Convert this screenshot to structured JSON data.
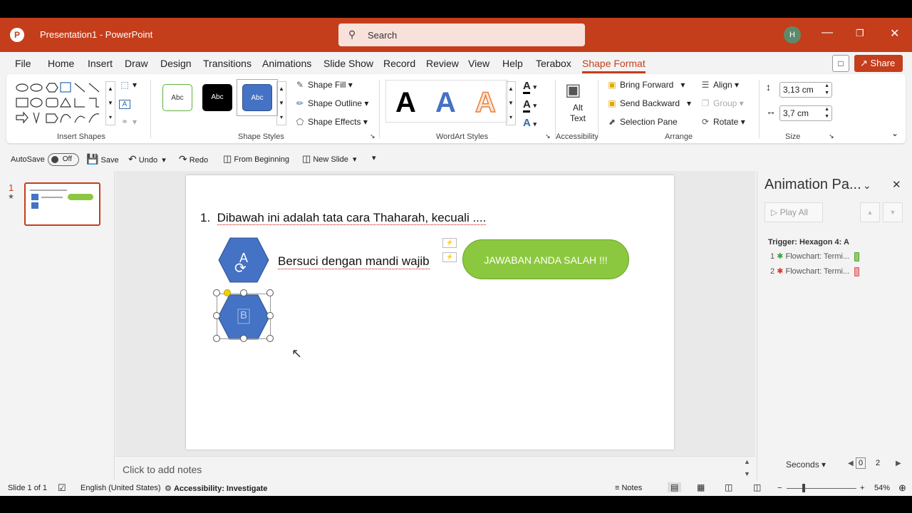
{
  "app": {
    "title": "Presentation1  -  PowerPoint",
    "logo": "P",
    "search_label": "Search",
    "avatar_initial": "H",
    "brand_color": "#c43e1c"
  },
  "menus": [
    "File",
    "Home",
    "Insert",
    "Draw",
    "Design",
    "Transitions",
    "Animations",
    "Slide Show",
    "Record",
    "Review",
    "View",
    "Help",
    "Terabox",
    "Shape Format"
  ],
  "active_menu": "Shape Format",
  "share_label": "Share",
  "ribbon": {
    "groups": {
      "insert_shapes": "Insert Shapes",
      "shape_styles": "Shape Styles",
      "wordart_styles": "WordArt Styles",
      "accessibility": "Accessibility",
      "arrange": "Arrange",
      "size": "Size"
    },
    "style_samples": [
      "Abc",
      "Abc",
      "Abc"
    ],
    "shape_fill": "Shape Fill",
    "shape_outline": "Shape Outline",
    "shape_effects": "Shape Effects",
    "wordart_letter": "A",
    "alt_text": "Alt Text",
    "bring_forward": "Bring Forward",
    "send_backward": "Send Backward",
    "selection_pane": "Selection Pane",
    "align": "Align",
    "group": "Group",
    "rotate": "Rotate",
    "height": "3,13 cm",
    "width": "3,7 cm"
  },
  "qat": {
    "autosave": "AutoSave",
    "autosave_state": "Off",
    "save": "Save",
    "undo": "Undo",
    "redo": "Redo",
    "from_beginning": "From Beginning",
    "new_slide": "New Slide"
  },
  "thumb_number": "1",
  "slide": {
    "question_number": "1.",
    "question": "Dibawah ini adalah tata cara Thaharah, kecuali ....",
    "hexagon_a_label": "A",
    "hexagon_b_label": "B",
    "option_a_text": "Bersuci dengan mandi wajib",
    "feedback": "JAWABAN ANDA SALAH !!!"
  },
  "notes_placeholder": "Click to add notes",
  "animation_pane": {
    "title": "Animation Pa...",
    "play_all": "Play All",
    "trigger": "Trigger: Hexagon 4: A",
    "items": [
      {
        "num": "1",
        "label": "Flowchart: Termi...",
        "color": "#8cd06a"
      },
      {
        "num": "2",
        "label": "Flowchart: Termi...",
        "color": "#f2a0a0"
      }
    ],
    "seconds": "Seconds",
    "timeline": [
      "0",
      "2"
    ]
  },
  "status": {
    "slide_of": "Slide 1 of 1",
    "language": "English (United States)",
    "accessibility": "Accessibility: Investigate",
    "notes": "Notes",
    "zoom": "54%"
  }
}
